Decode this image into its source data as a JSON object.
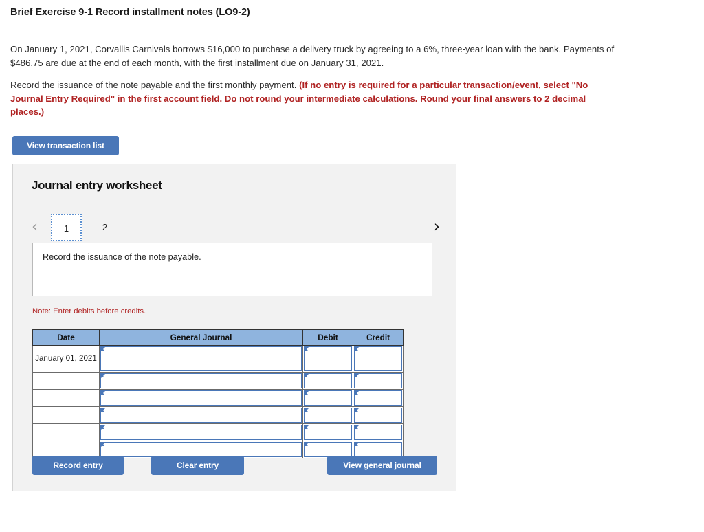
{
  "question": {
    "title": "Brief Exercise 9-1 Record installment notes (LO9-2)",
    "paragraph_1": "On January 1, 2021, Corvallis Carnivals borrows $16,000 to purchase a delivery truck by agreeing to a 6%, three-year loan with the bank. Payments of $486.75 are due at the end of each month, with the first installment due on January 31, 2021.",
    "paragraph_2_plain": "Record the issuance of the note payable and the first monthly payment. ",
    "paragraph_2_emphasis": "(If no entry is required for a particular transaction/event, select \"No Journal Entry Required\" in the first account field. Do not round your intermediate calculations. Round your final answers to 2 decimal places.)"
  },
  "toolbar": {
    "view_transaction_list_label": "View transaction list"
  },
  "worksheet": {
    "title": "Journal entry worksheet",
    "pager": {
      "prev_icon": "chevron-left-icon",
      "next_icon": "chevron-right-icon",
      "tabs": [
        {
          "label": "1",
          "active": true
        },
        {
          "label": "2",
          "active": false
        }
      ]
    },
    "instruction": "Record the issuance of the note payable.",
    "note": "Note: Enter debits before credits.",
    "table": {
      "headers": [
        "Date",
        "General Journal",
        "Debit",
        "Credit"
      ],
      "rows": [
        {
          "date": "January 01, 2021",
          "general_journal": "",
          "debit": "",
          "credit": ""
        },
        {
          "date": "",
          "general_journal": "",
          "debit": "",
          "credit": ""
        },
        {
          "date": "",
          "general_journal": "",
          "debit": "",
          "credit": ""
        },
        {
          "date": "",
          "general_journal": "",
          "debit": "",
          "credit": ""
        },
        {
          "date": "",
          "general_journal": "",
          "debit": "",
          "credit": ""
        },
        {
          "date": "",
          "general_journal": "",
          "debit": "",
          "credit": ""
        }
      ]
    },
    "actions": {
      "record_entry_label": "Record entry",
      "clear_entry_label": "Clear entry",
      "view_general_journal_label": "View general journal"
    }
  },
  "colors": {
    "button_blue": "#4a77b8",
    "table_header_blue": "#8fb4de",
    "emphasis_red": "#b02323",
    "panel_gray": "#f2f2f2"
  }
}
